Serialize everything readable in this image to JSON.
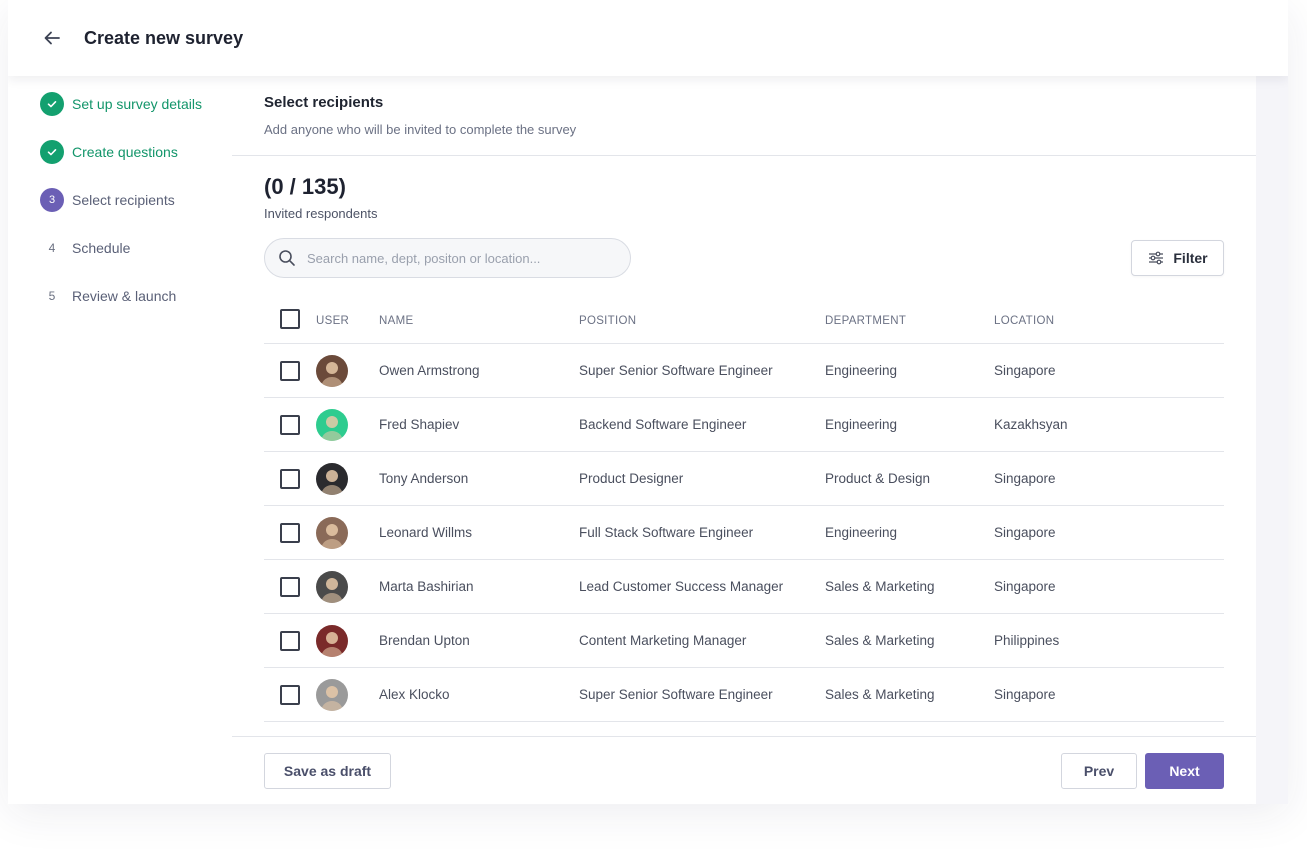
{
  "header": {
    "title": "Create new survey",
    "back_icon": "arrow-left-icon"
  },
  "steps": [
    {
      "marker": "✓",
      "label": "Set up survey details",
      "state": "done"
    },
    {
      "marker": "✓",
      "label": "Create questions",
      "state": "done"
    },
    {
      "marker": "3",
      "label": "Select recipients",
      "state": "active"
    },
    {
      "marker": "4",
      "label": "Schedule",
      "state": "todo"
    },
    {
      "marker": "5",
      "label": "Review & launch",
      "state": "todo"
    }
  ],
  "section": {
    "title": "Select recipients",
    "subtitle": "Add anyone who will be invited to complete the survey"
  },
  "summary": {
    "count": "(0 / 135)",
    "label": "Invited respondents"
  },
  "search": {
    "placeholder": "Search name, dept, positon or location...",
    "value": ""
  },
  "filter": {
    "label": "Filter"
  },
  "table": {
    "columns": {
      "user": "USER",
      "name": "NAME",
      "position": "POSITION",
      "department": "DEPARTMENT",
      "location": "LOCATION"
    },
    "rows": [
      {
        "name": "Owen Armstrong",
        "position": "Super Senior Software Engineer",
        "department": "Engineering",
        "location": "Singapore",
        "avatar_color": "#6b4a3a",
        "checked": false
      },
      {
        "name": "Fred Shapiev",
        "position": "Backend Software Engineer",
        "department": "Engineering",
        "location": "Kazakhsyan",
        "avatar_color": "#2ecc8f",
        "checked": false
      },
      {
        "name": "Tony Anderson",
        "position": "Product Designer",
        "department": "Product & Design",
        "location": "Singapore",
        "avatar_color": "#2a2a2e",
        "checked": false
      },
      {
        "name": "Leonard Willms",
        "position": "Full Stack Software Engineer",
        "department": "Engineering",
        "location": "Singapore",
        "avatar_color": "#8a6a58",
        "checked": false
      },
      {
        "name": "Marta Bashirian",
        "position": "Lead Customer Success Manager",
        "department": "Sales & Marketing",
        "location": "Singapore",
        "avatar_color": "#4a4a4a",
        "checked": false
      },
      {
        "name": "Brendan Upton",
        "position": "Content Marketing Manager",
        "department": "Sales & Marketing",
        "location": "Philippines",
        "avatar_color": "#7a2a2a",
        "checked": false
      },
      {
        "name": "Alex Klocko",
        "position": "Super Senior Software Engineer",
        "department": "Sales & Marketing",
        "location": "Singapore",
        "avatar_color": "#9a9a9a",
        "checked": false
      }
    ]
  },
  "footer": {
    "draft_label": "Save as draft",
    "prev_label": "Prev",
    "next_label": "Next"
  },
  "colors": {
    "accent": "#6b5fb5",
    "success": "#13a06f"
  }
}
